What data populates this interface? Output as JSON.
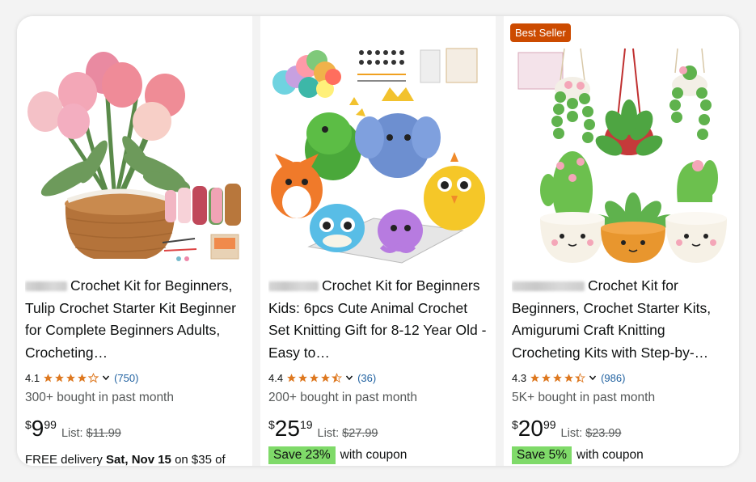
{
  "products": [
    {
      "title": "Crochet Kit for Beginners, Tulip Crochet Starter Kit Beginner for Complete Beginners Adults, Crocheting…",
      "rating": "4.1",
      "stars": 4.1,
      "review_count": "(750)",
      "bought": "300+ bought in past month",
      "price_symbol": "$",
      "price_whole": "9",
      "price_fraction": "99",
      "list_label": "List:",
      "list_price": "$11.99",
      "delivery_prefix": "FREE delivery ",
      "delivery_date": "Sat, Nov 15",
      "delivery_suffix": " on $35 of"
    },
    {
      "title": "Crochet Kit for Beginners Kids: 6pcs Cute Animal Crochet Set Knitting Gift for 8-12 Year Old - Easy to…",
      "rating": "4.4",
      "stars": 4.4,
      "review_count": "(36)",
      "bought": "200+ bought in past month",
      "price_symbol": "$",
      "price_whole": "25",
      "price_fraction": "19",
      "list_label": "List:",
      "list_price": "$27.99",
      "save_label": "Save 23%",
      "coupon_text": "with coupon"
    },
    {
      "badge": "Best Seller",
      "title": "Crochet Kit for Beginners, Crochet Starter Kits, Amigurumi Craft Knitting Crocheting Kits with Step-by-…",
      "rating": "4.3",
      "stars": 4.3,
      "review_count": "(986)",
      "bought": "5K+ bought in past month",
      "price_symbol": "$",
      "price_whole": "20",
      "price_fraction": "99",
      "list_label": "List:",
      "list_price": "$23.99",
      "save_label": "Save 5%",
      "coupon_text": "with coupon"
    }
  ],
  "colors": {
    "star": "#de7921",
    "link": "#2162a1",
    "badge": "#cc4b00",
    "save": "#7fda69"
  }
}
